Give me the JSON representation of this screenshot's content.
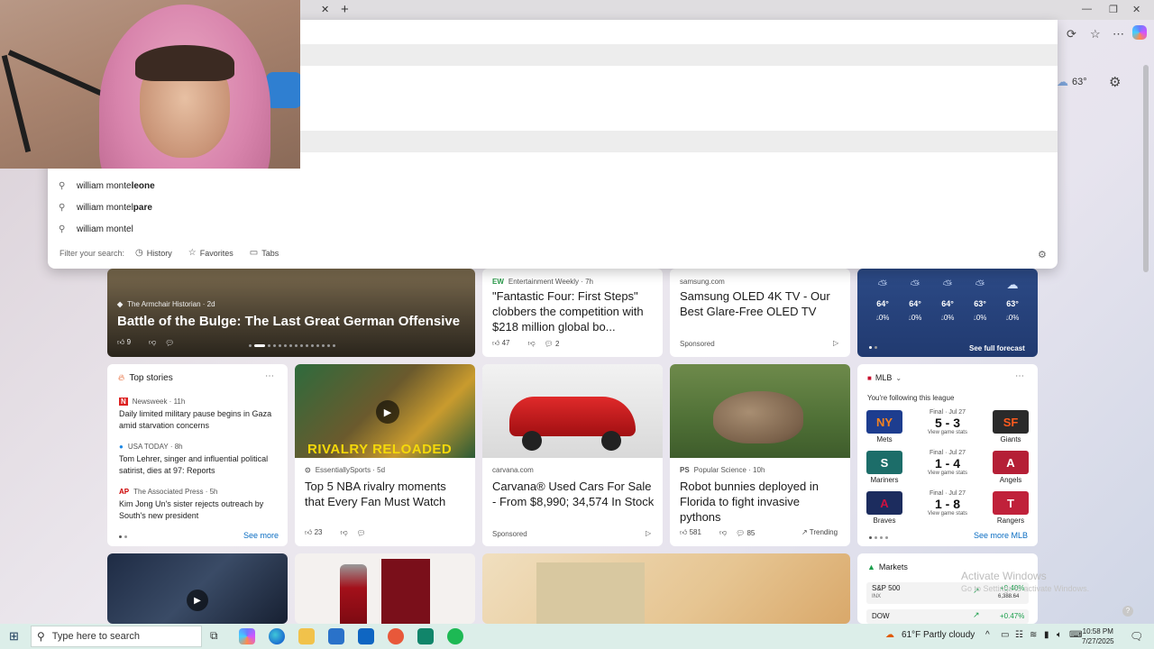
{
  "omnibox": {
    "suggestions": [
      {
        "prefix": "william monte",
        "bold": "leone"
      },
      {
        "prefix": "william montel",
        "bold": "pare"
      },
      {
        "prefix": "william montel",
        "bold": ""
      }
    ],
    "filter_label": "Filter your search:",
    "filters": [
      "History",
      "Favorites",
      "Tabs"
    ]
  },
  "weather_top": {
    "temp": "63°"
  },
  "hero": {
    "source": "The Armchair Historian · 2d",
    "title": "Battle of the Bulge: The Last Great German Offensive",
    "likes": "9"
  },
  "card_ew": {
    "source": "Entertainment Weekly · 7h",
    "headline": "\"Fantastic Four: First Steps\" clobbers the competition with $218 million global bo...",
    "likes": "47",
    "comments": "2"
  },
  "card_samsung": {
    "source": "samsung.com",
    "headline": "Samsung OLED 4K TV - Our Best Glare-Free OLED TV",
    "sponsored": "Sponsored"
  },
  "weather_card": {
    "cols": [
      {
        "temp": "64°",
        "precip": "0%"
      },
      {
        "temp": "64°",
        "precip": "0%"
      },
      {
        "temp": "64°",
        "precip": "0%"
      },
      {
        "temp": "63°",
        "precip": "0%"
      },
      {
        "temp": "63°",
        "precip": "0%"
      }
    ],
    "full_forecast": "See full forecast"
  },
  "top_stories": {
    "title": "Top stories",
    "items": [
      {
        "source": "Newsweek · 11h",
        "headline": "Daily limited military pause begins in Gaza amid starvation concerns"
      },
      {
        "source": "USA TODAY · 8h",
        "headline": "Tom Lehrer, singer and influential political satirist, dies at 97: Reports"
      },
      {
        "source": "The Associated Press · 5h",
        "headline": "Kim Jong Un's sister rejects outreach by South's new president"
      }
    ],
    "see_more": "See more"
  },
  "card_nba": {
    "image_caption": "RIVALRY RELOADED",
    "source": "EssentiallySports · 5d",
    "headline": "Top 5 NBA rivalry moments that Every Fan Must Watch",
    "likes": "23"
  },
  "card_carvana": {
    "source": "carvana.com",
    "headline": "Carvana® Used Cars For Sale - From $8,990; 34,574 In Stock",
    "sponsored": "Sponsored"
  },
  "card_bunny": {
    "source": "Popular Science · 10h",
    "headline": "Robot bunnies deployed in Florida to fight invasive pythons",
    "likes": "581",
    "comments": "85",
    "trending": "Trending"
  },
  "mlb": {
    "title": "MLB",
    "subtitle": "You're following this league",
    "games": [
      {
        "home": "Mets",
        "away": "Giants",
        "home_logo": "NY",
        "away_logo": "SF",
        "final": "Final · Jul 27",
        "score": "5 - 3",
        "view": "View game stats",
        "home_color": "#1d3d8f",
        "away_color": "#2a2a2a"
      },
      {
        "home": "Mariners",
        "away": "Angels",
        "home_logo": "S",
        "away_logo": "A",
        "final": "Final · Jul 27",
        "score": "1 - 4",
        "view": "View game stats",
        "home_color": "#1c6d69",
        "away_color": "#b51f36"
      },
      {
        "home": "Braves",
        "away": "Rangers",
        "home_logo": "A",
        "away_logo": "T",
        "final": "Final · Jul 27",
        "score": "1 - 8",
        "view": "View game stats",
        "home_color": "#1c2c5e",
        "away_color": "#c0213a"
      }
    ],
    "see_more": "See more MLB"
  },
  "markets": {
    "title": "Markets",
    "rows": [
      {
        "name": "S&P 500",
        "sub": "INX",
        "change": "+0.40%",
        "value": "6,388.64"
      },
      {
        "name": "DOW",
        "sub": "",
        "change": "+0.47%",
        "value": ""
      }
    ]
  },
  "watermark": {
    "line1": "Activate Windows",
    "line2": "Go to Settings to activate Windows."
  },
  "taskbar": {
    "search_placeholder": "Type here to search",
    "weather": "61°F  Partly cloudy",
    "time": "10:58 PM",
    "date": "7/27/2025"
  }
}
